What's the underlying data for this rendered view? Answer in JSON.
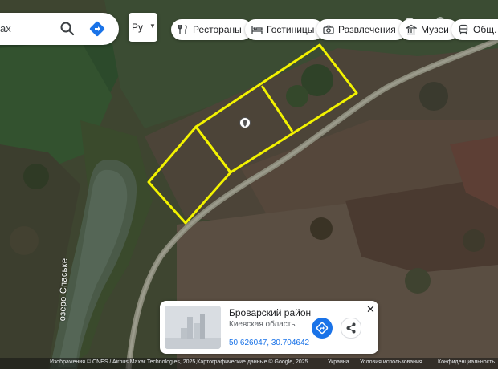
{
  "search": {
    "value_fragment": "ах"
  },
  "language": {
    "label": "Ру"
  },
  "chips": [
    {
      "label": "Рестораны",
      "icon": "restaurant-icon"
    },
    {
      "label": "Гостиницы",
      "icon": "hotel-icon"
    },
    {
      "label": "Развлечения",
      "icon": "camera-icon"
    },
    {
      "label": "Музеи",
      "icon": "museum-icon"
    },
    {
      "label": "Общ. тр",
      "icon": "transit-icon"
    }
  ],
  "map_labels": {
    "lake": "озеро Спаське"
  },
  "place_card": {
    "title": "Броварский район",
    "subtitle": "Киевская область",
    "coordinates": "50.626047, 30.704642"
  },
  "attribution": {
    "imagery": "Изображения © CNES / Airbus,Maxar Technologies, 2025,Картографические данные © Google, 2025",
    "country": "Украина",
    "terms": "Условия использования",
    "privacy": "Конфиденциальность"
  },
  "colors": {
    "parcel_outline": "#f2f200",
    "accent": "#1a73e8"
  }
}
